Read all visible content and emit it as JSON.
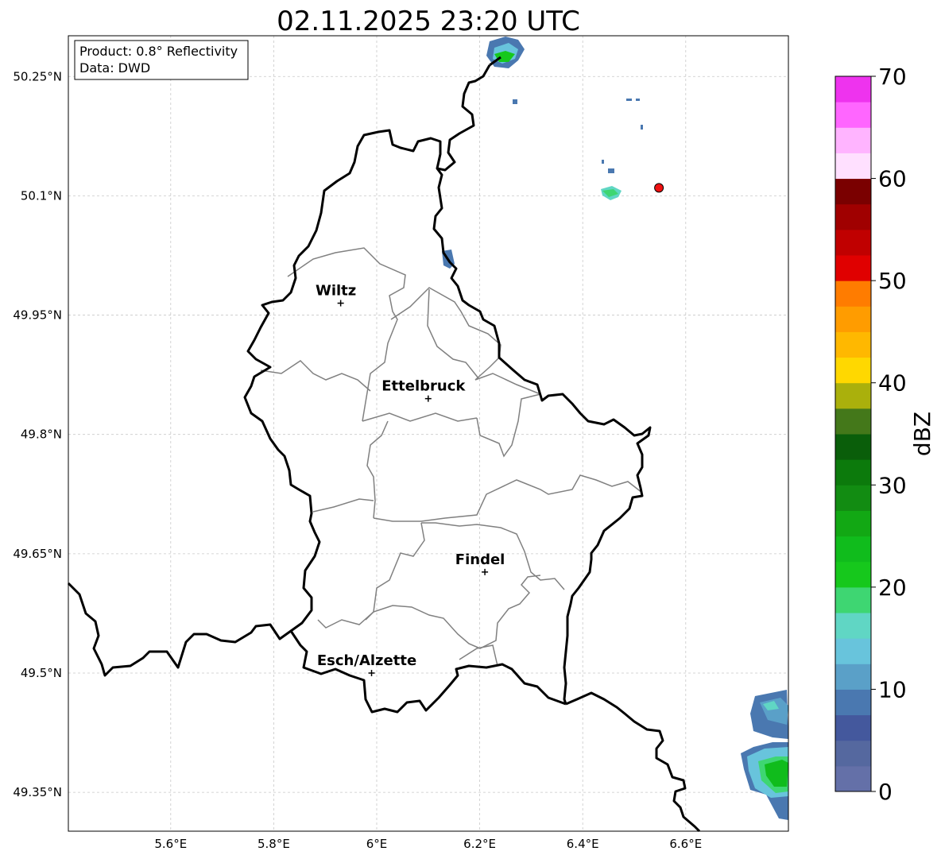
{
  "title": "02.11.2025 23:20 UTC",
  "info_box": {
    "product": "Product: 0.8° Reflectivity",
    "source": "Data: DWD"
  },
  "axes": {
    "lon_ticks": [
      "5.6°E",
      "5.8°E",
      "6°E",
      "6.2°E",
      "6.4°E",
      "6.6°E"
    ],
    "lat_ticks": [
      "50.25°N",
      "50.1°N",
      "49.95°N",
      "49.8°N",
      "49.65°N",
      "49.5°N",
      "49.35°N"
    ]
  },
  "cities": [
    {
      "name": "Wiltz",
      "lon": 5.93,
      "lat": 49.965
    },
    {
      "name": "Ettelbruck",
      "lon": 6.1,
      "lat": 49.845
    },
    {
      "name": "Findel",
      "lon": 6.21,
      "lat": 49.627
    },
    {
      "name": "Esch/Alzette",
      "lon": 5.99,
      "lat": 49.5
    }
  ],
  "radar_site": {
    "lon": 6.548,
    "lat": 50.11,
    "color": "#ee1111"
  },
  "colorbar": {
    "label": "dBZ",
    "ticks": [
      "0",
      "10",
      "20",
      "30",
      "40",
      "50",
      "60",
      "70"
    ],
    "min": 0,
    "max": 70,
    "colors": [
      "#6470a8",
      "#55689f",
      "#44589d",
      "#4a78b0",
      "#5aa0c8",
      "#68c4dc",
      "#60d6c4",
      "#3ed672",
      "#16c81c",
      "#10bc1c",
      "#12a814",
      "#128c12",
      "#0c7a0c",
      "#0a5e0a",
      "#44781a",
      "#aab00c",
      "#ffd800",
      "#ffb800",
      "#ff9c00",
      "#ff7c00",
      "#e00000",
      "#c00000",
      "#a00000",
      "#7a0000",
      "#ffe0ff",
      "#ffb4ff",
      "#ff66ff",
      "#ee33ee"
    ]
  }
}
